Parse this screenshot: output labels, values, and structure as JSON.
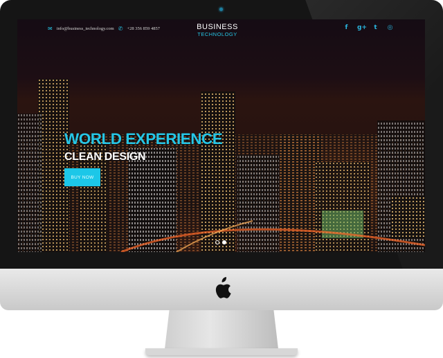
{
  "header": {
    "email": "info@business_technology.com",
    "phone": "+28 356 859 4857",
    "email_icon": "envelope-icon",
    "phone_icon": "phone-icon"
  },
  "brand": {
    "line1": "BUSINESS",
    "line2": "TECHNOLOGY"
  },
  "social": [
    {
      "icon": "facebook-icon",
      "glyph": "f"
    },
    {
      "icon": "google-plus-icon",
      "glyph": "g+"
    },
    {
      "icon": "twitter-icon",
      "glyph": "t"
    },
    {
      "icon": "dribbble-icon",
      "glyph": "◎"
    }
  ],
  "hero": {
    "title": "WORLD EXPERIENCE",
    "subtitle": "CLEAN DESIGN",
    "button": "BUY NOW"
  },
  "slider": {
    "slides": 2,
    "active": 2
  },
  "colors": {
    "accent": "#26c6e6",
    "bezel": "#151515",
    "chin": "#dcdcdc"
  }
}
